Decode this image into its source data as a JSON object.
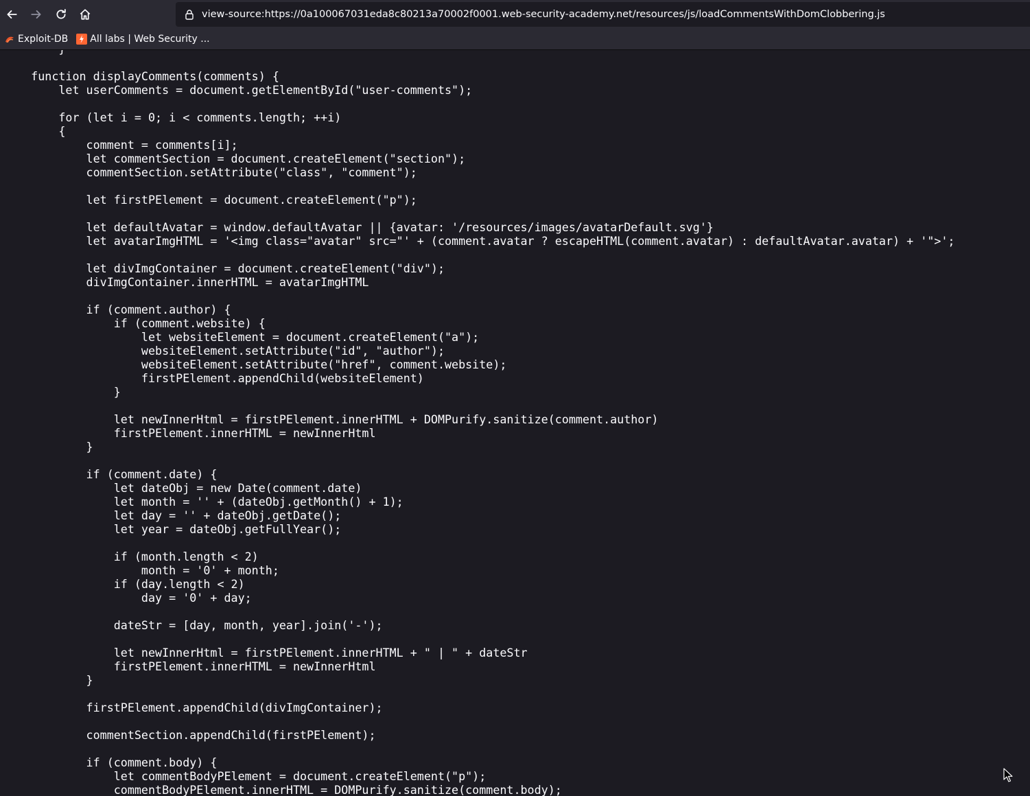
{
  "toolbar": {
    "back_icon": "arrow-left-icon",
    "forward_icon": "arrow-right-icon",
    "reload_icon": "reload-icon",
    "home_icon": "home-icon",
    "url": "view-source:https://0a100067031eda8c80213a70002f0001.web-security-academy.net/resources/js/loadCommentsWithDomClobbering.js"
  },
  "bookmarks": [
    {
      "label": "Exploit-DB",
      "icon": "exploit-db-icon"
    },
    {
      "label": "All labs | Web Security ...",
      "icon": "portswigger-icon"
    }
  ],
  "colors": {
    "toolbar_bg": "#2b2a33",
    "page_bg": "#1c1b22",
    "text": "#fbfbfe",
    "accent_orange": "#ff6633"
  },
  "code_lines": [
    "        }",
    "",
    "    function displayComments(comments) {",
    "        let userComments = document.getElementById(\"user-comments\");",
    "",
    "        for (let i = 0; i < comments.length; ++i)",
    "        {",
    "            comment = comments[i];",
    "            let commentSection = document.createElement(\"section\");",
    "            commentSection.setAttribute(\"class\", \"comment\");",
    "",
    "            let firstPElement = document.createElement(\"p\");",
    "",
    "            let defaultAvatar = window.defaultAvatar || {avatar: '/resources/images/avatarDefault.svg'}",
    "            let avatarImgHTML = '<img class=\"avatar\" src=\"' + (comment.avatar ? escapeHTML(comment.avatar) : defaultAvatar.avatar) + '\">';",
    "",
    "            let divImgContainer = document.createElement(\"div\");",
    "            divImgContainer.innerHTML = avatarImgHTML",
    "",
    "            if (comment.author) {",
    "                if (comment.website) {",
    "                    let websiteElement = document.createElement(\"a\");",
    "                    websiteElement.setAttribute(\"id\", \"author\");",
    "                    websiteElement.setAttribute(\"href\", comment.website);",
    "                    firstPElement.appendChild(websiteElement)",
    "                }",
    "",
    "                let newInnerHtml = firstPElement.innerHTML + DOMPurify.sanitize(comment.author)",
    "                firstPElement.innerHTML = newInnerHtml",
    "            }",
    "",
    "            if (comment.date) {",
    "                let dateObj = new Date(comment.date)",
    "                let month = '' + (dateObj.getMonth() + 1);",
    "                let day = '' + dateObj.getDate();",
    "                let year = dateObj.getFullYear();",
    "",
    "                if (month.length < 2)",
    "                    month = '0' + month;",
    "                if (day.length < 2)",
    "                    day = '0' + day;",
    "",
    "                dateStr = [day, month, year].join('-');",
    "",
    "                let newInnerHtml = firstPElement.innerHTML + \" | \" + dateStr",
    "                firstPElement.innerHTML = newInnerHtml",
    "            }",
    "",
    "            firstPElement.appendChild(divImgContainer);",
    "",
    "            commentSection.appendChild(firstPElement);",
    "",
    "            if (comment.body) {",
    "                let commentBodyPElement = document.createElement(\"p\");",
    "                commentBodyPElement.innerHTML = DOMPurify.sanitize(comment.body);"
  ]
}
